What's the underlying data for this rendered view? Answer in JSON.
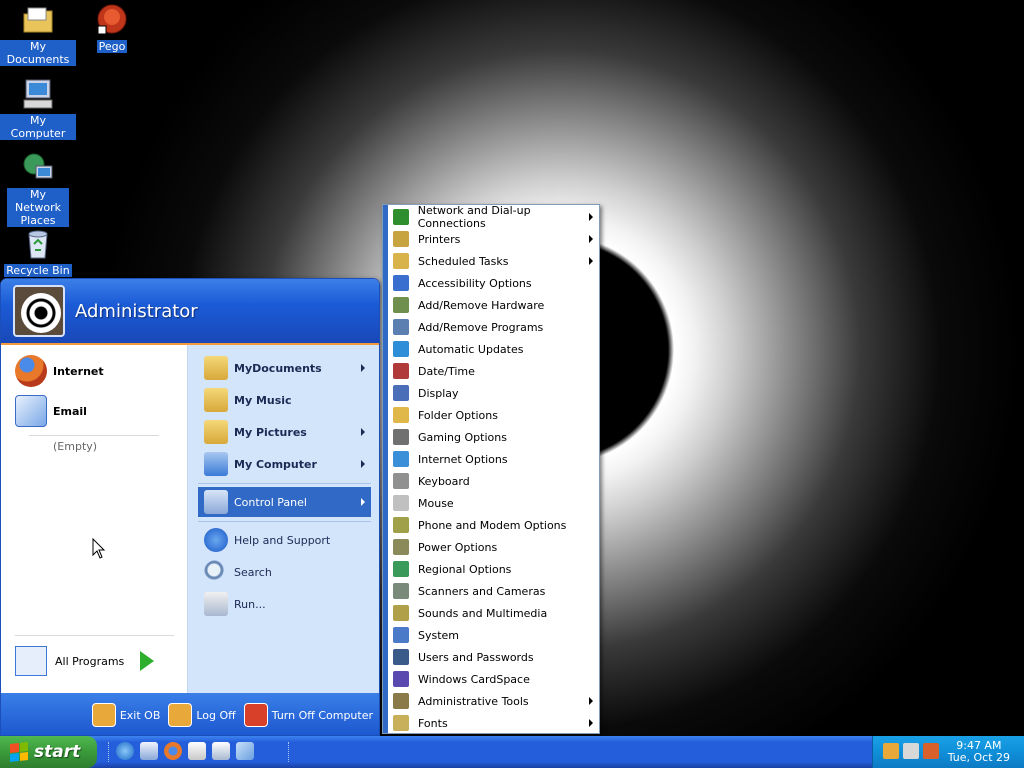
{
  "desktop": {
    "icons": [
      {
        "label": "My Documents",
        "icon": "my-documents-icon"
      },
      {
        "label": "Pego",
        "icon": "pego-shortcut-icon"
      },
      {
        "label": "My Computer",
        "icon": "my-computer-icon"
      },
      {
        "label": "My Network Places",
        "icon": "network-places-icon"
      },
      {
        "label": "Recycle Bin",
        "icon": "recycle-bin-icon"
      }
    ]
  },
  "start_menu": {
    "username": "Administrator",
    "left": {
      "pinned": [
        {
          "label": "Internet",
          "icon": "firefox-icon"
        },
        {
          "label": "Email",
          "icon": "email-icon"
        }
      ],
      "empty_label": "(Empty)",
      "all_programs": "All Programs"
    },
    "right": {
      "items": [
        {
          "label": "MyDocuments",
          "icon": "folder-icon",
          "bold": true,
          "arrow": true
        },
        {
          "label": "My Music",
          "icon": "music-folder-icon",
          "bold": true,
          "arrow": false
        },
        {
          "label": "My Pictures",
          "icon": "pictures-folder-icon",
          "bold": true,
          "arrow": true
        },
        {
          "label": "My Computer",
          "icon": "computer-icon",
          "bold": true,
          "arrow": true
        },
        {
          "label": "Control Panel",
          "icon": "control-panel-icon",
          "bold": false,
          "arrow": true,
          "selected": true
        },
        {
          "label": "Help and Support",
          "icon": "help-icon",
          "bold": false,
          "arrow": false
        },
        {
          "label": "Search",
          "icon": "search-icon",
          "bold": false,
          "arrow": false
        },
        {
          "label": "Run...",
          "icon": "run-icon",
          "bold": false,
          "arrow": false
        }
      ]
    },
    "footer": {
      "exit": "Exit OB",
      "logoff": "Log Off",
      "turnoff": "Turn Off Computer"
    }
  },
  "control_panel_menu": {
    "items": [
      {
        "label": "Network and Dial-up Connections",
        "arrow": true,
        "color": "#2f8f2f"
      },
      {
        "label": "Printers",
        "arrow": true,
        "color": "#c8a440"
      },
      {
        "label": "Scheduled Tasks",
        "arrow": true,
        "color": "#d8b24a"
      },
      {
        "label": "Accessibility Options",
        "arrow": false,
        "color": "#3a6fd0"
      },
      {
        "label": "Add/Remove Hardware",
        "arrow": false,
        "color": "#6f8f4f"
      },
      {
        "label": "Add/Remove Programs",
        "arrow": false,
        "color": "#5a7fb0"
      },
      {
        "label": "Automatic Updates",
        "arrow": false,
        "color": "#2e8fd8"
      },
      {
        "label": "Date/Time",
        "arrow": false,
        "color": "#b03a3a"
      },
      {
        "label": "Display",
        "arrow": false,
        "color": "#4a6fb8"
      },
      {
        "label": "Folder Options",
        "arrow": false,
        "color": "#e0b84a"
      },
      {
        "label": "Gaming Options",
        "arrow": false,
        "color": "#707070"
      },
      {
        "label": "Internet Options",
        "arrow": false,
        "color": "#3a8fd8"
      },
      {
        "label": "Keyboard",
        "arrow": false,
        "color": "#909090"
      },
      {
        "label": "Mouse",
        "arrow": false,
        "color": "#c0c0c0"
      },
      {
        "label": "Phone and Modem Options",
        "arrow": false,
        "color": "#a0a04a"
      },
      {
        "label": "Power Options",
        "arrow": false,
        "color": "#8a8a5a"
      },
      {
        "label": "Regional Options",
        "arrow": false,
        "color": "#3a9a5a"
      },
      {
        "label": "Scanners and Cameras",
        "arrow": false,
        "color": "#7a8a7a"
      },
      {
        "label": "Sounds and Multimedia",
        "arrow": false,
        "color": "#b0a04a"
      },
      {
        "label": "System",
        "arrow": false,
        "color": "#4a7ac8"
      },
      {
        "label": "Users and Passwords",
        "arrow": false,
        "color": "#3a5a8a"
      },
      {
        "label": "Windows CardSpace",
        "arrow": false,
        "color": "#5a4ab0"
      },
      {
        "label": "Administrative Tools",
        "arrow": true,
        "color": "#8a7a4a"
      },
      {
        "label": "Fonts",
        "arrow": true,
        "color": "#c8b05a"
      }
    ]
  },
  "taskbar": {
    "start_label": "start",
    "quicklaunch": [
      "ie-icon",
      "outlook-icon",
      "firefox-icon",
      "notepad-icon",
      "window-icon",
      "plane-icon"
    ],
    "tray_icons": [
      "tray-app-icon",
      "tray-network-icon",
      "tray-security-icon"
    ],
    "time": "9:47 AM",
    "date": "Tue, Oct 29"
  }
}
